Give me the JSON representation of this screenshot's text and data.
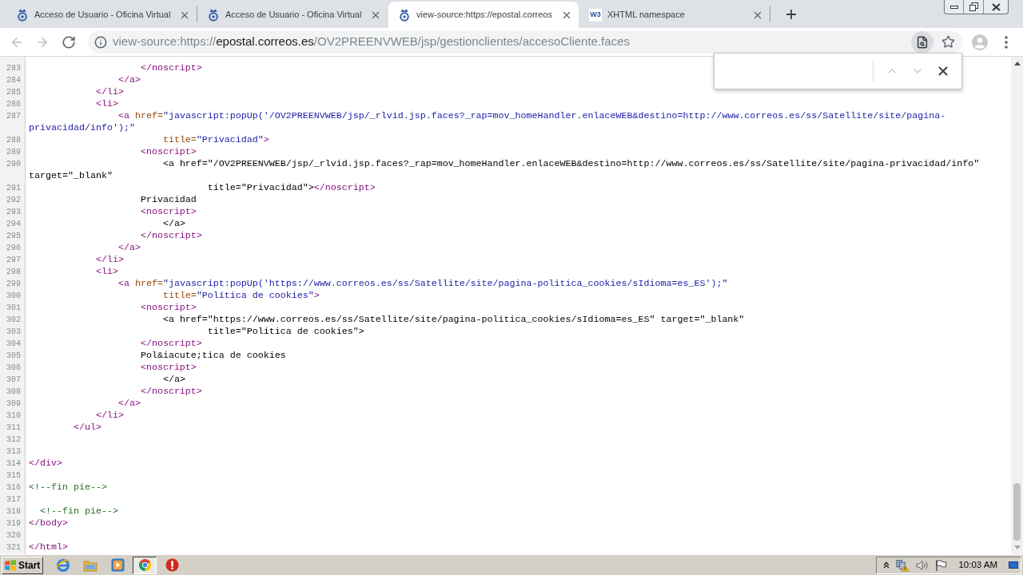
{
  "tabs": [
    {
      "title": "Acceso de Usuario - Oficina Virtual",
      "selected": false
    },
    {
      "title": "Acceso de Usuario - Oficina Virtual",
      "selected": false
    },
    {
      "title": "view-source:https://epostal.correos",
      "selected": true
    },
    {
      "title": "XHTML namespace",
      "favicon_text": "W3",
      "selected": false
    }
  ],
  "toolbar": {
    "back": {
      "disabled": true
    },
    "forward": {
      "disabled": true
    },
    "address": {
      "scheme": "view-source:https://",
      "host": "epostal.correos.es",
      "path": "/OV2PREENVWEB/jsp/gestionclientes/accesoCliente.faces"
    },
    "find_button": {
      "active": true
    }
  },
  "find_bar": {
    "previous": {
      "disabled": true
    },
    "next": {
      "disabled": true
    }
  },
  "source_lines": [
    {
      "number": "283",
      "tokens": [
        {
          "kind": "tag",
          "text": "                    </noscript>"
        }
      ]
    },
    {
      "number": "284",
      "tokens": [
        {
          "kind": "tag",
          "text": "                </a>"
        }
      ]
    },
    {
      "number": "285",
      "tokens": [
        {
          "kind": "tag",
          "text": "            </li>"
        }
      ]
    },
    {
      "number": "286",
      "tokens": [
        {
          "kind": "tag",
          "text": "            <li>"
        }
      ]
    },
    {
      "number": "287",
      "tokens": [
        {
          "kind": "tag",
          "text": "                <a"
        },
        {
          "kind": "attr",
          "text": " href="
        },
        {
          "kind": "value",
          "text": "\"javascript:popUp('/OV2PREENVWEB/jsp/_rlvid.jsp.faces?_rap=mov_homeHandler.enlaceWEB&destino=http://www.correos.es/ss/Satellite/site/pagina-privacidad/info');\""
        }
      ]
    },
    {
      "number": "288",
      "tokens": [
        {
          "kind": "attr",
          "text": "                        title="
        },
        {
          "kind": "value",
          "text": "\"Privacidad\""
        },
        {
          "kind": "tag",
          "text": ">"
        }
      ]
    },
    {
      "number": "289",
      "tokens": [
        {
          "kind": "tag",
          "text": "                    <noscript>"
        }
      ]
    },
    {
      "number": "290",
      "tokens": [
        {
          "kind": "text",
          "text": "                        <a href=\"/OV2PREENVWEB/jsp/_rlvid.jsp.faces?_rap=mov_homeHandler.enlaceWEB&destino=http://www.correos.es/ss/Satellite/site/pagina-privacidad/info\" target=\"_blank\""
        }
      ]
    },
    {
      "number": "291",
      "tokens": [
        {
          "kind": "text",
          "text": "                                title=\"Privacidad\">"
        },
        {
          "kind": "tag",
          "text": "</noscript>"
        }
      ]
    },
    {
      "number": "292",
      "tokens": [
        {
          "kind": "text",
          "text": "                    Privacidad"
        }
      ]
    },
    {
      "number": "293",
      "tokens": [
        {
          "kind": "tag",
          "text": "                    <noscript>"
        }
      ]
    },
    {
      "number": "294",
      "tokens": [
        {
          "kind": "text",
          "text": "                        </a>"
        }
      ]
    },
    {
      "number": "295",
      "tokens": [
        {
          "kind": "tag",
          "text": "                    </noscript>"
        }
      ]
    },
    {
      "number": "296",
      "tokens": [
        {
          "kind": "tag",
          "text": "                </a>"
        }
      ]
    },
    {
      "number": "297",
      "tokens": [
        {
          "kind": "tag",
          "text": "            </li>"
        }
      ]
    },
    {
      "number": "298",
      "tokens": [
        {
          "kind": "tag",
          "text": "            <li>"
        }
      ]
    },
    {
      "number": "299",
      "tokens": [
        {
          "kind": "tag",
          "text": "                <a"
        },
        {
          "kind": "attr",
          "text": " href="
        },
        {
          "kind": "value",
          "text": "\"javascript:popUp('https://www.correos.es/ss/Satellite/site/pagina-politica_cookies/sIdioma=es_ES');\""
        }
      ]
    },
    {
      "number": "300",
      "tokens": [
        {
          "kind": "attr",
          "text": "                        title="
        },
        {
          "kind": "value",
          "text": "\"Política de cookies\""
        },
        {
          "kind": "tag",
          "text": ">"
        }
      ]
    },
    {
      "number": "301",
      "tokens": [
        {
          "kind": "tag",
          "text": "                    <noscript>"
        }
      ]
    },
    {
      "number": "302",
      "tokens": [
        {
          "kind": "text",
          "text": "                        <a href=\"https://www.correos.es/ss/Satellite/site/pagina-politica_cookies/sIdioma=es_ES\" target=\"_blank\""
        }
      ]
    },
    {
      "number": "303",
      "tokens": [
        {
          "kind": "text",
          "text": "                                title=\"Política de cookies\">"
        }
      ]
    },
    {
      "number": "304",
      "tokens": [
        {
          "kind": "tag",
          "text": "                    </noscript>"
        }
      ]
    },
    {
      "number": "305",
      "tokens": [
        {
          "kind": "text",
          "text": "                    Pol&iacute;tica de cookies"
        }
      ]
    },
    {
      "number": "306",
      "tokens": [
        {
          "kind": "tag",
          "text": "                    <noscript>"
        }
      ]
    },
    {
      "number": "307",
      "tokens": [
        {
          "kind": "text",
          "text": "                        </a>"
        }
      ]
    },
    {
      "number": "308",
      "tokens": [
        {
          "kind": "tag",
          "text": "                    </noscript>"
        }
      ]
    },
    {
      "number": "309",
      "tokens": [
        {
          "kind": "tag",
          "text": "                </a>"
        }
      ]
    },
    {
      "number": "310",
      "tokens": [
        {
          "kind": "tag",
          "text": "            </li>"
        }
      ]
    },
    {
      "number": "311",
      "tokens": [
        {
          "kind": "tag",
          "text": "        </ul>"
        }
      ]
    },
    {
      "number": "312"
    },
    {
      "number": "313"
    },
    {
      "number": "314",
      "tokens": [
        {
          "kind": "tag",
          "text": "</div>"
        }
      ]
    },
    {
      "number": "315"
    },
    {
      "number": "316",
      "tokens": [
        {
          "kind": "comment",
          "text": "<!--fin pie-->"
        }
      ]
    },
    {
      "number": "317"
    },
    {
      "number": "318",
      "tokens": [
        {
          "kind": "comment",
          "text": "  <!--fin pie-->"
        }
      ]
    },
    {
      "number": "319",
      "tokens": [
        {
          "kind": "tag",
          "text": "</body>"
        }
      ]
    },
    {
      "number": "320"
    },
    {
      "number": "321",
      "tokens": [
        {
          "kind": "tag",
          "text": "</html>"
        }
      ]
    }
  ],
  "taskbar": {
    "start": "Start",
    "apps": [
      {
        "selected": false
      },
      {
        "selected": false
      },
      {
        "selected": false
      },
      {
        "selected": true
      },
      {
        "selected": false
      }
    ],
    "clock": "10:03 AM"
  }
}
